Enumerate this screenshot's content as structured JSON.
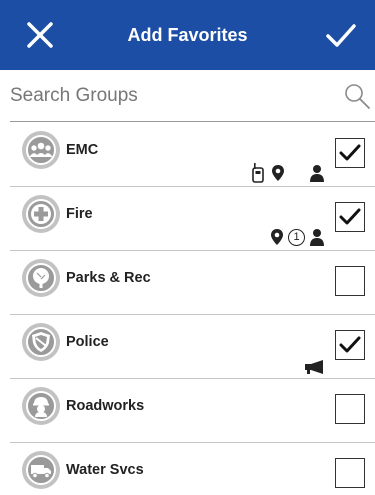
{
  "header": {
    "title": "Add Favorites",
    "close_icon": "close-icon",
    "confirm_icon": "check-icon",
    "bar_color": "#1c4ea5"
  },
  "search": {
    "placeholder": "Search Groups",
    "value": "",
    "icon": "search-icon"
  },
  "groups": [
    {
      "name": "EMC",
      "icon": "people-group-icon",
      "checked": true,
      "status_icons": [
        "radio-icon",
        "location-pin-icon",
        "person-icon"
      ]
    },
    {
      "name": "Fire",
      "icon": "cross-icon",
      "checked": true,
      "status_icons": [
        "location-pin-icon",
        "count-badge",
        "person-icon"
      ],
      "count": "1"
    },
    {
      "name": "Parks & Rec",
      "icon": "tree-icon",
      "checked": false,
      "status_icons": []
    },
    {
      "name": "Police",
      "icon": "shield-icon",
      "checked": true,
      "status_icons": [
        "megaphone-icon"
      ]
    },
    {
      "name": "Roadworks",
      "icon": "worker-icon",
      "checked": false,
      "status_icons": []
    },
    {
      "name": "Water Svcs",
      "icon": "truck-icon",
      "checked": false,
      "status_icons": []
    }
  ]
}
